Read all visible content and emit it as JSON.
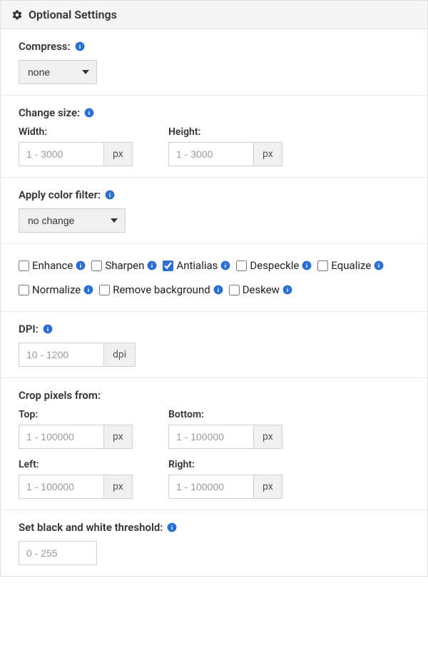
{
  "header": {
    "title": "Optional Settings"
  },
  "compress": {
    "label": "Compress:",
    "selected": "none"
  },
  "changeSize": {
    "label": "Change size:",
    "width": {
      "label": "Width:",
      "placeholder": "1 - 3000",
      "unit": "px"
    },
    "height": {
      "label": "Height:",
      "placeholder": "1 - 3000",
      "unit": "px"
    }
  },
  "colorFilter": {
    "label": "Apply color filter:",
    "selected": "no change"
  },
  "flags": {
    "enhance": {
      "label": "Enhance",
      "checked": false
    },
    "sharpen": {
      "label": "Sharpen",
      "checked": false
    },
    "antialias": {
      "label": "Antialias",
      "checked": true
    },
    "despeckle": {
      "label": "Despeckle",
      "checked": false
    },
    "equalize": {
      "label": "Equalize",
      "checked": false
    },
    "normalize": {
      "label": "Normalize",
      "checked": false
    },
    "removeBg": {
      "label": "Remove background",
      "checked": false
    },
    "deskew": {
      "label": "Deskew",
      "checked": false
    }
  },
  "dpi": {
    "label": "DPI:",
    "placeholder": "10 - 1200",
    "unit": "dpi"
  },
  "crop": {
    "label": "Crop pixels from:",
    "top": {
      "label": "Top:",
      "placeholder": "1 - 100000",
      "unit": "px"
    },
    "bottom": {
      "label": "Bottom:",
      "placeholder": "1 - 100000",
      "unit": "px"
    },
    "left": {
      "label": "Left:",
      "placeholder": "1 - 100000",
      "unit": "px"
    },
    "right": {
      "label": "Right:",
      "placeholder": "1 - 100000",
      "unit": "px"
    }
  },
  "bwThreshold": {
    "label": "Set black and white threshold:",
    "placeholder": "0 - 255"
  }
}
